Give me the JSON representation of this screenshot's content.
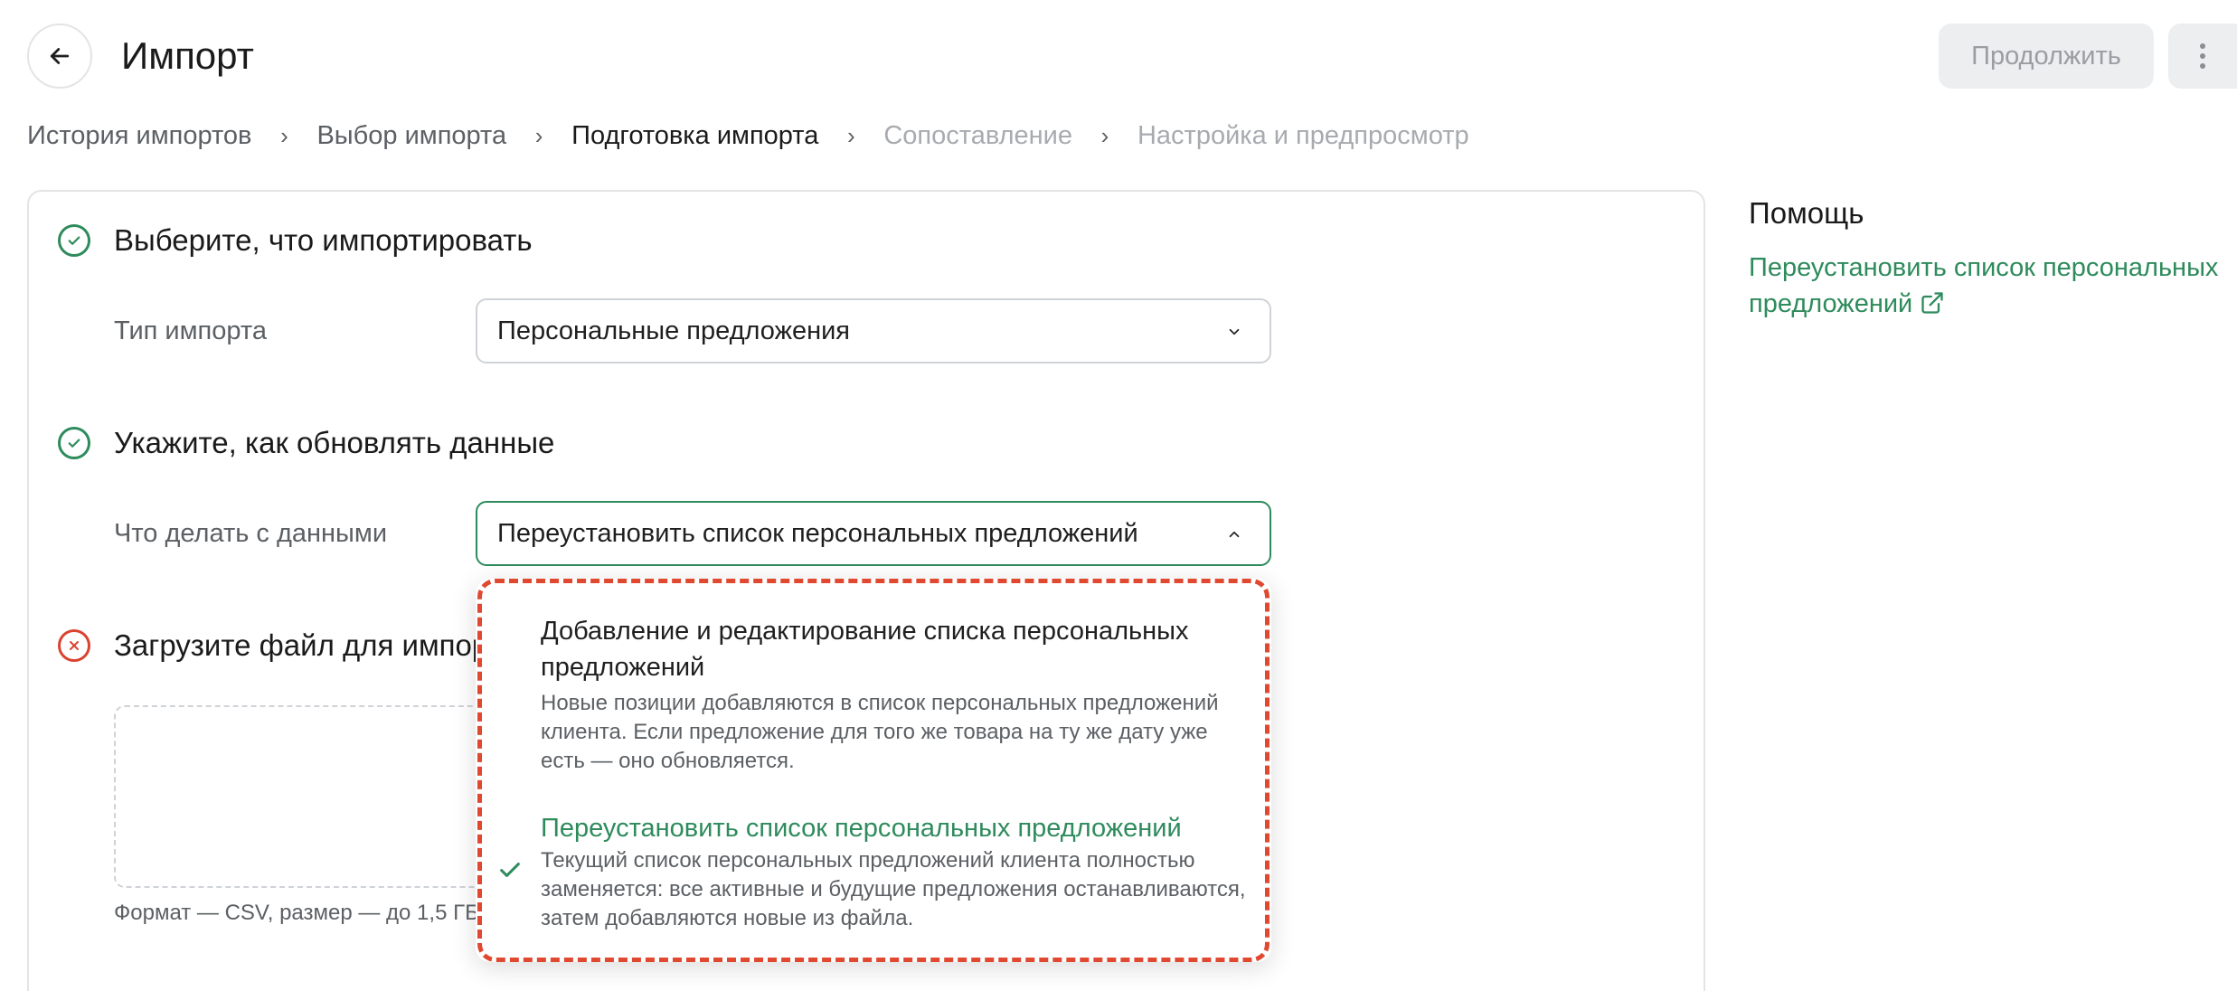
{
  "header": {
    "title": "Импорт",
    "continue_label": "Продолжить"
  },
  "breadcrumb": [
    {
      "label": "История импортов",
      "state": "link"
    },
    {
      "label": "Выбор импорта",
      "state": "link"
    },
    {
      "label": "Подготовка импорта",
      "state": "active"
    },
    {
      "label": "Сопоставление",
      "state": "disabled"
    },
    {
      "label": "Настройка и предпросмотр",
      "state": "disabled"
    }
  ],
  "steps": {
    "step1": {
      "title": "Выберите, что импортировать",
      "status": "done",
      "field_label": "Тип импорта",
      "field_value": "Персональные предложения"
    },
    "step2": {
      "title": "Укажите, как обновлять данные",
      "status": "done",
      "field_label": "Что делать с данными",
      "field_value": "Переустановить список персональных предложений"
    },
    "step3": {
      "title": "Загрузите файл для импорта",
      "status": "error",
      "hint": "Формат — CSV, размер — до 1,5 ГБ"
    }
  },
  "dropdown": {
    "options": [
      {
        "title": "Добавление и редактирование списка персональных предложений",
        "description": "Новые позиции добавляются в список персональных предложений клиента. Если предложение для того же товара на ту же дату уже есть — оно обновляется.",
        "selected": false
      },
      {
        "title": "Переустановить список персональных предложений",
        "description": "Текущий список персональных предложений клиента полностью заменяется: все активные и будущие предложения останавливаются, затем добавляются новые из файла.",
        "selected": true
      }
    ]
  },
  "help": {
    "title": "Помощь",
    "link_label": "Переустановить список персональных предложений"
  },
  "icons": {
    "back": "arrow-left-icon",
    "more": "more-vertical-icon",
    "chevron": "chevron-icon",
    "step_done": "check-circle-icon",
    "step_error": "x-circle-icon",
    "external": "external-link-icon",
    "selected": "check-icon"
  },
  "colors": {
    "accent": "#2e8b5c",
    "error": "#d9432f",
    "highlight_outline": "#e04830",
    "disabled_button_bg": "#eceef0"
  }
}
